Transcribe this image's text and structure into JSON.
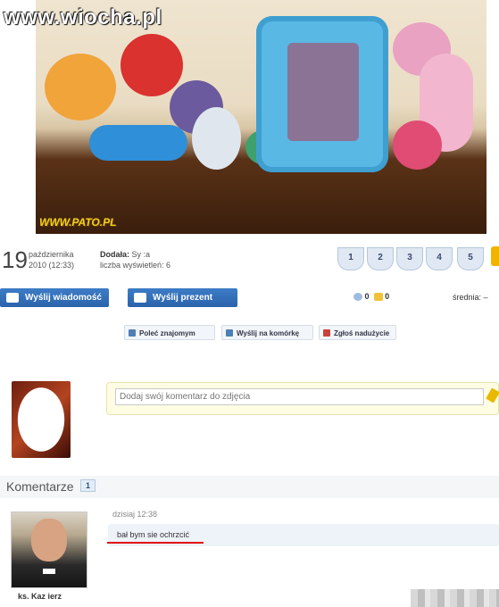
{
  "site": {
    "logo": "www.wiocha.pl",
    "photo_watermark": "WWW.PATO.PL"
  },
  "photo_info": {
    "day": "19",
    "month_line1": "października",
    "month_line2": "2010 (12:33)",
    "added_by_label": "Dodała:",
    "added_by_value": "Sy          :a",
    "views_label": "liczba wyświetleń:",
    "views_value": "6"
  },
  "rating": {
    "stars": [
      "1",
      "2",
      "3",
      "4",
      "5"
    ],
    "average_label": "średnia:",
    "average_value": "–"
  },
  "actions": {
    "send_message": "Wyślij wiadomość",
    "send_gift": "Wyślij prezent",
    "recommend": "Poleć znajomym",
    "send_to_phone": "Wyślij na komórkę",
    "report": "Zgłoś nadużycie"
  },
  "stats": {
    "comments_count": "0",
    "gifts_count": "0"
  },
  "comment_form": {
    "placeholder": "Dodaj swój komentarz do zdjęcia"
  },
  "comments": {
    "title": "Komentarze",
    "count": "1",
    "items": [
      {
        "author": "ks. Kaz    ierz",
        "time": "dzisiaj 12:38",
        "text": "bał bym sie ochrzcić"
      }
    ]
  },
  "colors": {
    "accent_blue": "#2a63ab",
    "highlight_underline": "#e01010"
  },
  "icons": [
    "envelope-icon",
    "gift-icon",
    "heart-icon",
    "gift-small-icon",
    "recommend-icon",
    "phone-icon",
    "report-icon",
    "pencil-icon"
  ]
}
